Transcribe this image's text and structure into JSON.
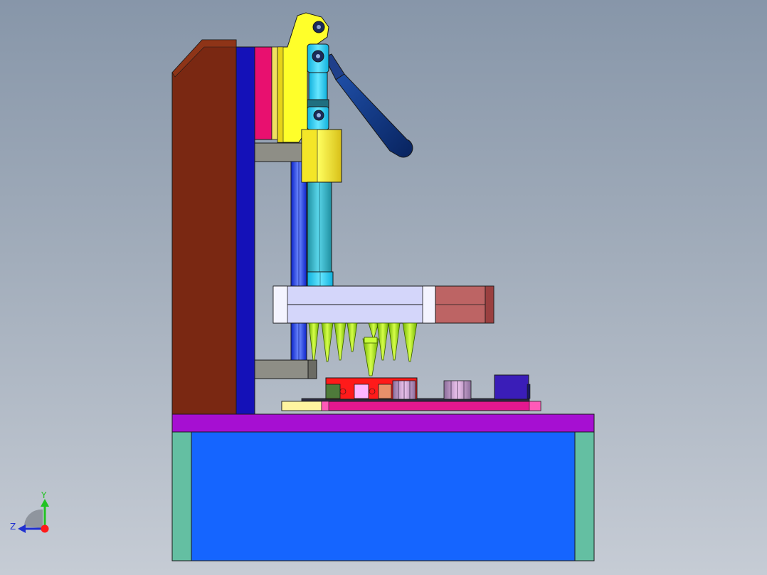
{
  "viewport": {
    "background_top": "#8796a9",
    "background_bottom": "#c6ccd5"
  },
  "triad": {
    "y_label": "Y",
    "z_label": "Z",
    "y_color": "#22c322",
    "z_color": "#2030d0",
    "x_color": "#ff1a1a"
  },
  "colors": {
    "base_cabinet": "#1565ff",
    "base_side_panels": "#64bfa2",
    "base_plate": "#a60fd2",
    "column_brown": "#7a2812",
    "column_blue": "#1411b8",
    "magenta_plate": "#e8106f",
    "yellow_clamp": "#ffff2a",
    "clamp_handle": "#0b2d7a",
    "cyan_link": "#22c8ee",
    "gray_brackets": "#8e8e86",
    "press_plate": "#d4d6fa",
    "press_plate_end": "#bd6464",
    "probe_pins": "#a8f20a",
    "fixture_red": "#ff1a1a",
    "fixture_plate_pink": "#e3188f",
    "purple_block": "#3a1db8"
  }
}
